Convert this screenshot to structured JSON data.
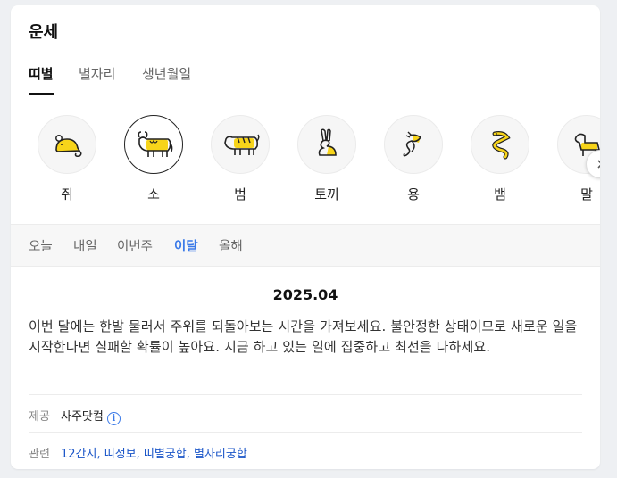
{
  "card": {
    "title": "운세"
  },
  "tabs": [
    {
      "label": "띠별",
      "active": true
    },
    {
      "label": "별자리",
      "active": false
    },
    {
      "label": "생년월일",
      "active": false
    }
  ],
  "zodiac": [
    {
      "label": "쥐",
      "icon": "rat-icon"
    },
    {
      "label": "소",
      "icon": "ox-icon",
      "selected": true
    },
    {
      "label": "범",
      "icon": "tiger-icon"
    },
    {
      "label": "토끼",
      "icon": "rabbit-icon"
    },
    {
      "label": "용",
      "icon": "dragon-icon"
    },
    {
      "label": "뱀",
      "icon": "snake-icon"
    },
    {
      "label": "말",
      "icon": "horse-icon"
    }
  ],
  "periods": [
    {
      "label": "오늘"
    },
    {
      "label": "내일"
    },
    {
      "label": "이번주"
    },
    {
      "label": "이달",
      "active": true
    },
    {
      "label": "올해"
    }
  ],
  "fortune": {
    "date": "2025.04",
    "text": "이번 달에는 한발 물러서 주위를 되돌아보는 시간을 가져보세요. 불안정한 상태이므로 새로운 일을 시작한다면 실패할 확률이 높아요. 지금 하고 있는 일에 집중하고 최선을 다하세요."
  },
  "provider": {
    "key": "제공",
    "value": "사주닷컴",
    "info_glyph": "i"
  },
  "related": {
    "key": "관련",
    "links": [
      "12간지",
      "띠정보",
      "띠별궁합",
      "별자리궁합"
    ],
    "separator": ", "
  },
  "colors": {
    "accent": "#3b7ae8",
    "link": "#1a55c8",
    "icon_yellow": "#f7d41a"
  }
}
